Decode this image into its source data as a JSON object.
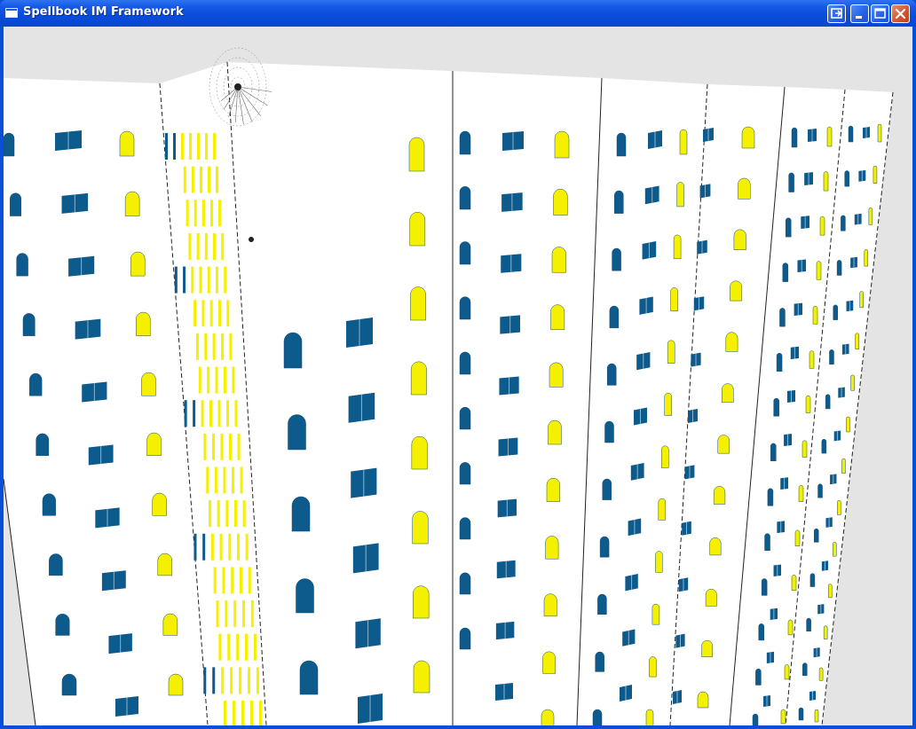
{
  "window": {
    "title": "Spellbook IM Framework",
    "icon": "app-window-icon",
    "controls": [
      {
        "name": "restore-to-tray-button",
        "icon": "tray-icon"
      },
      {
        "name": "minimize-button",
        "icon": "minimize-icon"
      },
      {
        "name": "maximize-button",
        "icon": "maximize-icon"
      },
      {
        "name": "close-button",
        "icon": "close-icon"
      }
    ]
  },
  "colors": {
    "titlebar": "#0b4fd8",
    "sky": "#e4e4e4",
    "facade": "#ffffff",
    "window_dark": "#0d5a8c",
    "window_lit": "#f4f000"
  },
  "scene": {
    "description_icon": "3d-building-scene"
  }
}
